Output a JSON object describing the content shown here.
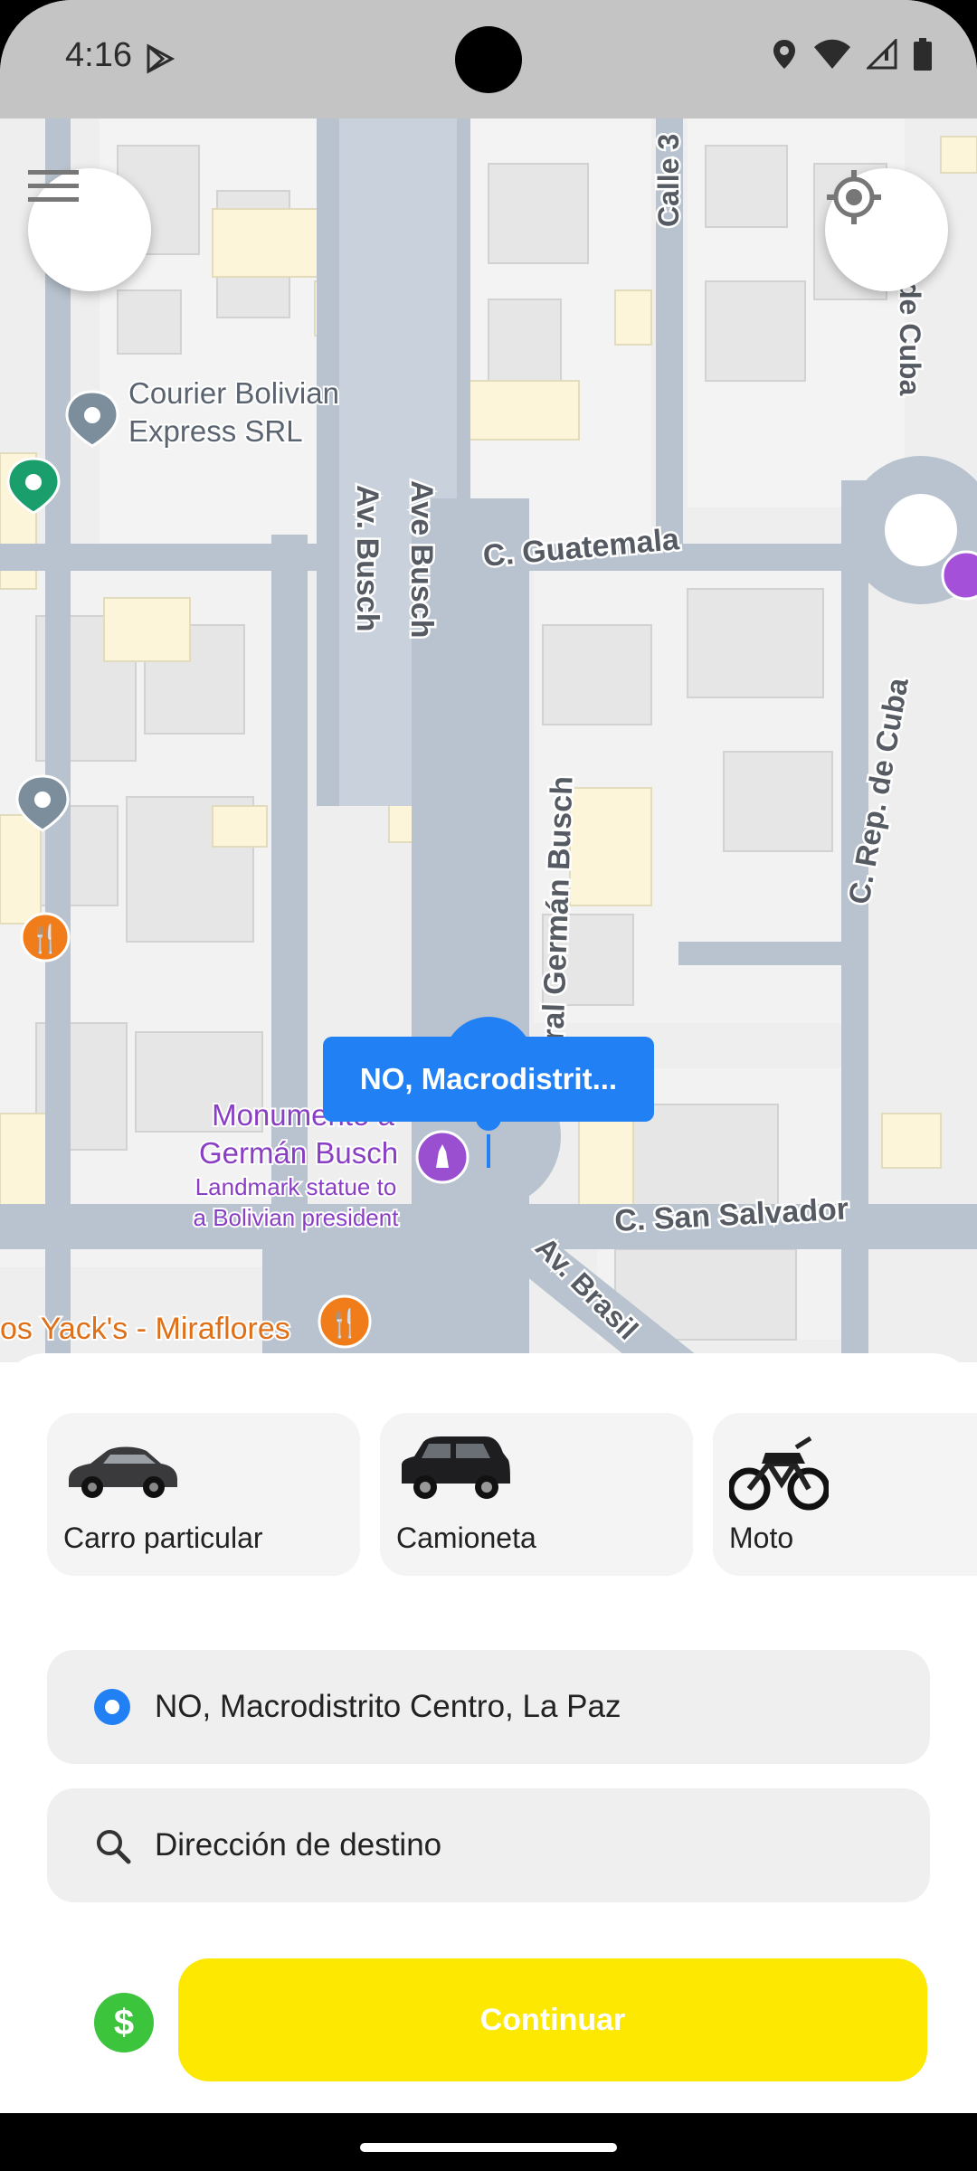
{
  "status_bar": {
    "time": "4:16"
  },
  "map": {
    "streets": {
      "guatemala": "C. Guatemala",
      "ave_busch": "Ave Busch",
      "av_busch": "Av. Busch",
      "lateral": "Lateral Germán Busch",
      "rep_cuba": "C. Rep. de Cuba",
      "san_salvador": "C. San Salvador",
      "calle": "Calle 3",
      "de_cuba": "de Cuba",
      "brasil": "Av. Brasil"
    },
    "places": {
      "courier": "Courier Bolivian\nExpress SRL",
      "monumento": "Monumento a\nGermán Busch",
      "monumento_desc": "Landmark statue to\na Bolivian president",
      "yacks": "os Yack's - Miraflores"
    },
    "pin_label": "NO, Macrodistrit..."
  },
  "vehicles": [
    {
      "label": "Carro particular",
      "icon": "sedan-car-icon"
    },
    {
      "label": "Camioneta",
      "icon": "suv-icon"
    },
    {
      "label": "Moto",
      "icon": "motorcycle-icon"
    }
  ],
  "origin": {
    "value": "NO, Macrodistrito Centro, La Paz"
  },
  "destination": {
    "placeholder": "Dirección de destino"
  },
  "actions": {
    "currency_symbol": "$",
    "continue_label": "Continuar"
  },
  "colors": {
    "accent_blue": "#2280f5",
    "continue_yellow": "#fce800",
    "money_green": "#3dc43d"
  }
}
